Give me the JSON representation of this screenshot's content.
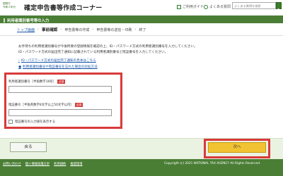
{
  "header": {
    "logo_lines": [
      "国税庁",
      "令和２年分"
    ],
    "app_title": "確定申告書等作成コーナー",
    "help_link": "ご利用ガイド",
    "faq_link": "よくある質問",
    "search_placeholder": "よくある質問を検索"
  },
  "page_heading": "利用者識別番号等の入力",
  "breadcrumb": {
    "top_link": "トップ画面",
    "steps": [
      "事前確認",
      "申告書等の作成",
      "申告書等の送信・印刷",
      "終了"
    ],
    "separator": "›"
  },
  "intro": {
    "line1": "お手持ちの利用者識別番号が今後所要の登録情報を確認の上、ID・パスワード方式の利用者識別番号を入力してください。",
    "line2": "ID・パスワード方式の届出完了通知に記載されている利用者識別番号と暗証番号を入力してください。"
  },
  "links": {
    "link1": "ID・パスワード方式の届出完了通知の見本はこちら",
    "link2": "利用者識別番号や暗証番号を忘れた場合の対処方法"
  },
  "form": {
    "user_id_label": "利用者識別番号［半角数字16桁］",
    "password_label": "暗証番号［半角英数字8文字以上50文字以内］",
    "required_badge": "必須",
    "show_password_label": "暗証番号の入力値を表示する"
  },
  "actions": {
    "back_label": "戻る",
    "next_label": "次へ"
  },
  "footer": {
    "links": [
      "お問い合わせ",
      "個人情報保護方針",
      "利用規約",
      "推奨環境"
    ],
    "copyright": "Copyright (c) 2021 NATIONAL TAX AGENCY All Rights Reserved."
  },
  "colors": {
    "brand_green": "#4a7e35",
    "highlight_red": "#d93a3a",
    "next_yellow": "#f1c232",
    "link_blue": "#1a57a8"
  }
}
